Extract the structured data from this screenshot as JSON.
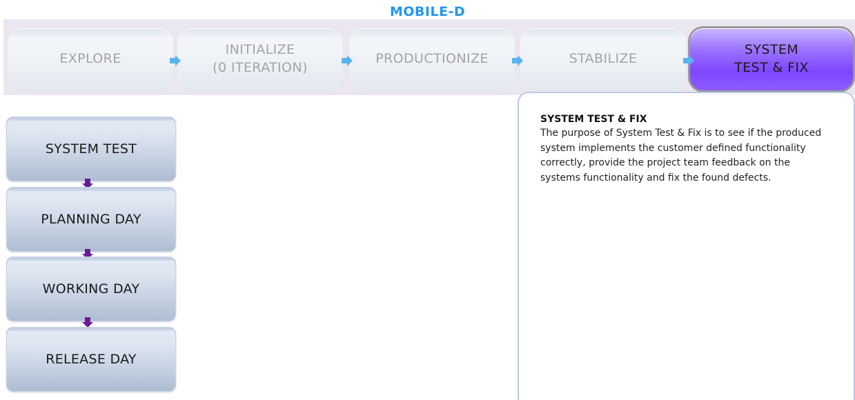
{
  "title": "MOBILE-D",
  "phases": [
    {
      "line1": "EXPLORE",
      "line2": ""
    },
    {
      "line1": "INITIALIZE",
      "line2": "(0 ITERATION)"
    },
    {
      "line1": "PRODUCTIONIZE",
      "line2": ""
    },
    {
      "line1": "STABILIZE",
      "line2": ""
    },
    {
      "line1": "SYSTEM",
      "line2": "TEST & FIX"
    }
  ],
  "active_phase": "SYSTEM TEST & FIX",
  "stages": [
    "SYSTEM TEST",
    "PLANNING DAY",
    "WORKING DAY",
    "RELEASE DAY"
  ],
  "info": {
    "title": "SYSTEM TEST & FIX",
    "text": "The purpose of System Test & Fix is to see if the produced system implements the customer defined functionality correctly, provide the project team feedback on the systems functionality and fix the found defects."
  },
  "colors": {
    "title": "#2196f3",
    "active_phase": "#8c5cff",
    "phase_arrow": "#5ab4f0",
    "stage_arrow": "#6a1b9a"
  },
  "icons": {
    "phase_arrow": "arrow-right-icon",
    "stage_arrow": "arrow-down-icon"
  }
}
